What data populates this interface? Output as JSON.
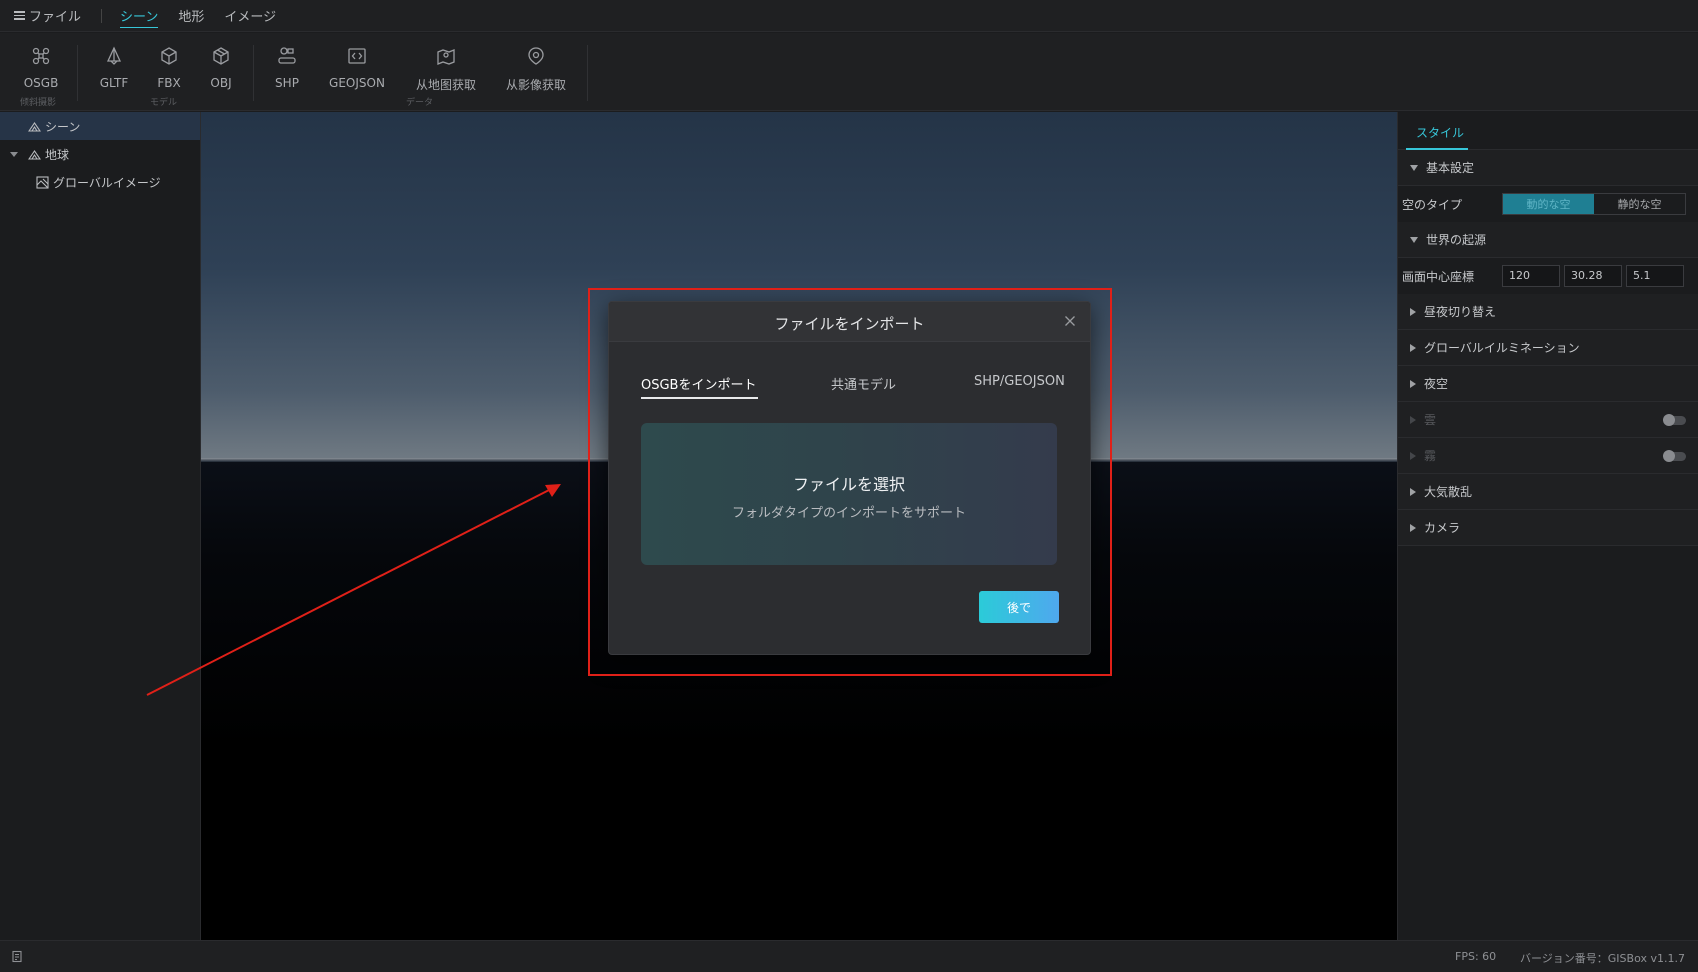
{
  "menubar": {
    "file": "ファイル",
    "items": [
      "シーン",
      "地形",
      "イメージ"
    ],
    "active": "シーン"
  },
  "toolbar": {
    "tools": [
      {
        "label": "OSGB",
        "icon": "drone-icon"
      },
      {
        "label": "GLTF",
        "icon": "bell-shape-icon"
      },
      {
        "label": "FBX",
        "icon": "cube-icon"
      },
      {
        "label": "OBJ",
        "icon": "box-icon"
      },
      {
        "label": "SHP",
        "icon": "shapes-icon"
      },
      {
        "label": "GEOJSON",
        "icon": "code-icon"
      },
      {
        "label": "从地图获取",
        "icon": "map-pin-icon"
      },
      {
        "label": "从影像获取",
        "icon": "image-pin-icon"
      }
    ],
    "groups": [
      "倾斜摄影",
      "モデル",
      "データ"
    ]
  },
  "tree": {
    "items": [
      {
        "label": "シーン",
        "icon": "scene-icon"
      },
      {
        "label": "地球",
        "icon": "earth-icon"
      },
      {
        "label": "グローバルイメージ",
        "icon": "image-layer-icon"
      }
    ]
  },
  "rightpanel": {
    "tab": "スタイル",
    "basic_section": "基本設定",
    "sky_type_label": "空のタイプ",
    "sky_dynamic": "動的な空",
    "sky_static": "静的な空",
    "origin_section": "世界の起源",
    "center_label": "画面中心座標",
    "coords": [
      "120",
      "30.28",
      "5.1"
    ],
    "sections": [
      "昼夜切り替え",
      "グローバルイルミネーション",
      "夜空"
    ],
    "toggle_sections": [
      "雲",
      "霧"
    ],
    "sections2": [
      "大気散乱",
      "カメラ"
    ]
  },
  "status": {
    "fps": "FPS: 60",
    "version": "バージョン番号：GISBox v1.1.7"
  },
  "modal": {
    "title": "ファイルをインポート",
    "tabs": [
      "OSGBをインポート",
      "共通モデル",
      "SHP/GEOJSON"
    ],
    "dropzone_title": "ファイルを選択",
    "dropzone_sub": "フォルダタイプのインポートをサポート",
    "later_button": "後で"
  },
  "colors": {
    "accent": "#37c6d8",
    "annotation": "#e02018"
  }
}
